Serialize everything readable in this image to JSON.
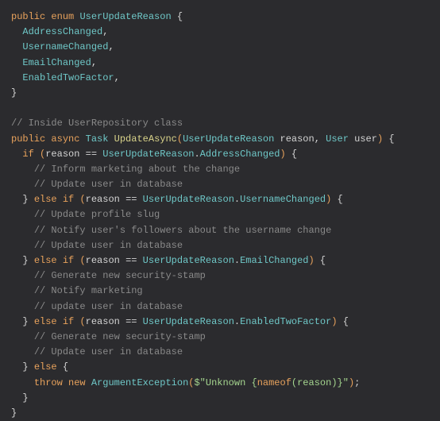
{
  "code": {
    "enumDecl": {
      "access": "public",
      "kw": "enum",
      "name": "UserUpdateReason",
      "members": [
        "AddressChanged",
        "UsernameChanged",
        "EmailChanged",
        "EnabledTwoFactor"
      ]
    },
    "commentClass": "// Inside UserRepository class",
    "methodDecl": {
      "access": "public",
      "async": "async",
      "returnType": "Task",
      "name": "UpdateAsync",
      "paramType1": "UserUpdateReason",
      "paramName1": "reason",
      "paramType2": "User",
      "paramName2": "user"
    },
    "branches": {
      "if1": {
        "reasonVar": "reason",
        "enumType": "UserUpdateReason",
        "enumVal": "AddressChanged",
        "comments": [
          "// Inform marketing about the change",
          "// Update user in database"
        ]
      },
      "if2": {
        "reasonVar": "reason",
        "enumType": "UserUpdateReason",
        "enumVal": "UsernameChanged",
        "comments": [
          "// Update profile slug",
          "// Notify user's followers about the username change",
          "// Update user in database"
        ]
      },
      "if3": {
        "reasonVar": "reason",
        "enumType": "UserUpdateReason",
        "enumVal": "EmailChanged",
        "comments": [
          "// Generate new security-stamp",
          "// Notify marketing",
          "// update user in database"
        ]
      },
      "if4": {
        "reasonVar": "reason",
        "enumType": "UserUpdateReason",
        "enumVal": "EnabledTwoFactor",
        "comments": [
          "// Generate new security-stamp",
          "// Update user in database"
        ]
      },
      "elseThrow": {
        "throw": "throw",
        "newKw": "new",
        "exType": "ArgumentException",
        "strPrefix": "$\"Unknown {",
        "nameof": "nameof",
        "nameofArg": "reason",
        "strSuffix": ")}\""
      }
    }
  }
}
